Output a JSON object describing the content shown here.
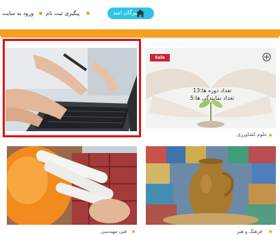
{
  "nav": {
    "login": "ورود به سایت",
    "track": "پیگیری ثبت نام",
    "news": "خبرگان امید"
  },
  "cards": [
    {
      "id": "laptop",
      "caption": ""
    },
    {
      "id": "agriculture",
      "badge": "Sale",
      "info_line1": "تعداد دوره ها:13",
      "info_line2": "تعداد نمایندگی ها:5",
      "caption": "علوم کشاورزی"
    },
    {
      "id": "engineering",
      "caption": "فنی مهندسی"
    },
    {
      "id": "culture",
      "caption": "فرهنگ و هنر"
    }
  ],
  "colors": {
    "accent": "#f5a021",
    "pill": "#31c3e6",
    "highlight": "#e01010",
    "badge": "#cc2233"
  },
  "icons": [
    "home-icon",
    "zoom-icon"
  ]
}
